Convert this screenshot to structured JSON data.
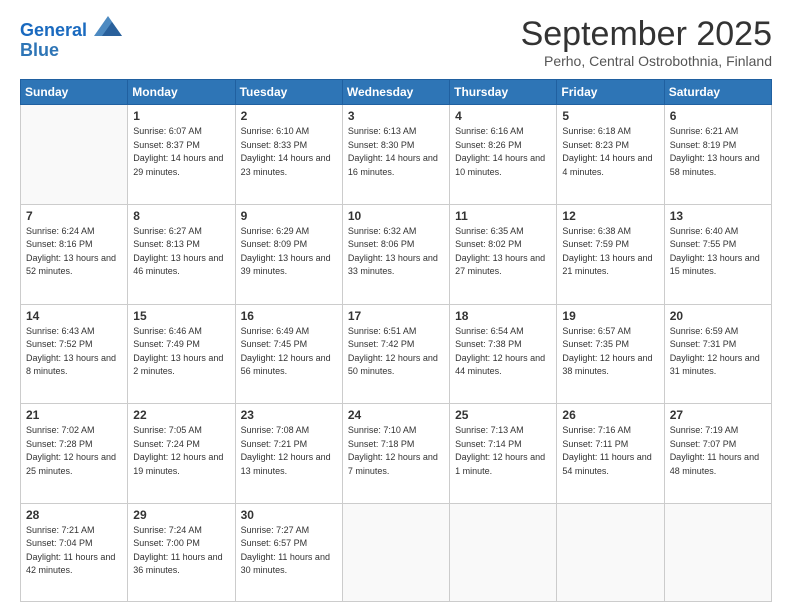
{
  "logo": {
    "line1": "General",
    "line2": "Blue"
  },
  "title": "September 2025",
  "subtitle": "Perho, Central Ostrobothnia, Finland",
  "days_header": [
    "Sunday",
    "Monday",
    "Tuesday",
    "Wednesday",
    "Thursday",
    "Friday",
    "Saturday"
  ],
  "weeks": [
    [
      {
        "day": "",
        "info": ""
      },
      {
        "day": "1",
        "info": "Sunrise: 6:07 AM\nSunset: 8:37 PM\nDaylight: 14 hours\nand 29 minutes."
      },
      {
        "day": "2",
        "info": "Sunrise: 6:10 AM\nSunset: 8:33 PM\nDaylight: 14 hours\nand 23 minutes."
      },
      {
        "day": "3",
        "info": "Sunrise: 6:13 AM\nSunset: 8:30 PM\nDaylight: 14 hours\nand 16 minutes."
      },
      {
        "day": "4",
        "info": "Sunrise: 6:16 AM\nSunset: 8:26 PM\nDaylight: 14 hours\nand 10 minutes."
      },
      {
        "day": "5",
        "info": "Sunrise: 6:18 AM\nSunset: 8:23 PM\nDaylight: 14 hours\nand 4 minutes."
      },
      {
        "day": "6",
        "info": "Sunrise: 6:21 AM\nSunset: 8:19 PM\nDaylight: 13 hours\nand 58 minutes."
      }
    ],
    [
      {
        "day": "7",
        "info": "Sunrise: 6:24 AM\nSunset: 8:16 PM\nDaylight: 13 hours\nand 52 minutes."
      },
      {
        "day": "8",
        "info": "Sunrise: 6:27 AM\nSunset: 8:13 PM\nDaylight: 13 hours\nand 46 minutes."
      },
      {
        "day": "9",
        "info": "Sunrise: 6:29 AM\nSunset: 8:09 PM\nDaylight: 13 hours\nand 39 minutes."
      },
      {
        "day": "10",
        "info": "Sunrise: 6:32 AM\nSunset: 8:06 PM\nDaylight: 13 hours\nand 33 minutes."
      },
      {
        "day": "11",
        "info": "Sunrise: 6:35 AM\nSunset: 8:02 PM\nDaylight: 13 hours\nand 27 minutes."
      },
      {
        "day": "12",
        "info": "Sunrise: 6:38 AM\nSunset: 7:59 PM\nDaylight: 13 hours\nand 21 minutes."
      },
      {
        "day": "13",
        "info": "Sunrise: 6:40 AM\nSunset: 7:55 PM\nDaylight: 13 hours\nand 15 minutes."
      }
    ],
    [
      {
        "day": "14",
        "info": "Sunrise: 6:43 AM\nSunset: 7:52 PM\nDaylight: 13 hours\nand 8 minutes."
      },
      {
        "day": "15",
        "info": "Sunrise: 6:46 AM\nSunset: 7:49 PM\nDaylight: 13 hours\nand 2 minutes."
      },
      {
        "day": "16",
        "info": "Sunrise: 6:49 AM\nSunset: 7:45 PM\nDaylight: 12 hours\nand 56 minutes."
      },
      {
        "day": "17",
        "info": "Sunrise: 6:51 AM\nSunset: 7:42 PM\nDaylight: 12 hours\nand 50 minutes."
      },
      {
        "day": "18",
        "info": "Sunrise: 6:54 AM\nSunset: 7:38 PM\nDaylight: 12 hours\nand 44 minutes."
      },
      {
        "day": "19",
        "info": "Sunrise: 6:57 AM\nSunset: 7:35 PM\nDaylight: 12 hours\nand 38 minutes."
      },
      {
        "day": "20",
        "info": "Sunrise: 6:59 AM\nSunset: 7:31 PM\nDaylight: 12 hours\nand 31 minutes."
      }
    ],
    [
      {
        "day": "21",
        "info": "Sunrise: 7:02 AM\nSunset: 7:28 PM\nDaylight: 12 hours\nand 25 minutes."
      },
      {
        "day": "22",
        "info": "Sunrise: 7:05 AM\nSunset: 7:24 PM\nDaylight: 12 hours\nand 19 minutes."
      },
      {
        "day": "23",
        "info": "Sunrise: 7:08 AM\nSunset: 7:21 PM\nDaylight: 12 hours\nand 13 minutes."
      },
      {
        "day": "24",
        "info": "Sunrise: 7:10 AM\nSunset: 7:18 PM\nDaylight: 12 hours\nand 7 minutes."
      },
      {
        "day": "25",
        "info": "Sunrise: 7:13 AM\nSunset: 7:14 PM\nDaylight: 12 hours\nand 1 minute."
      },
      {
        "day": "26",
        "info": "Sunrise: 7:16 AM\nSunset: 7:11 PM\nDaylight: 11 hours\nand 54 minutes."
      },
      {
        "day": "27",
        "info": "Sunrise: 7:19 AM\nSunset: 7:07 PM\nDaylight: 11 hours\nand 48 minutes."
      }
    ],
    [
      {
        "day": "28",
        "info": "Sunrise: 7:21 AM\nSunset: 7:04 PM\nDaylight: 11 hours\nand 42 minutes."
      },
      {
        "day": "29",
        "info": "Sunrise: 7:24 AM\nSunset: 7:00 PM\nDaylight: 11 hours\nand 36 minutes."
      },
      {
        "day": "30",
        "info": "Sunrise: 7:27 AM\nSunset: 6:57 PM\nDaylight: 11 hours\nand 30 minutes."
      },
      {
        "day": "",
        "info": ""
      },
      {
        "day": "",
        "info": ""
      },
      {
        "day": "",
        "info": ""
      },
      {
        "day": "",
        "info": ""
      }
    ]
  ]
}
